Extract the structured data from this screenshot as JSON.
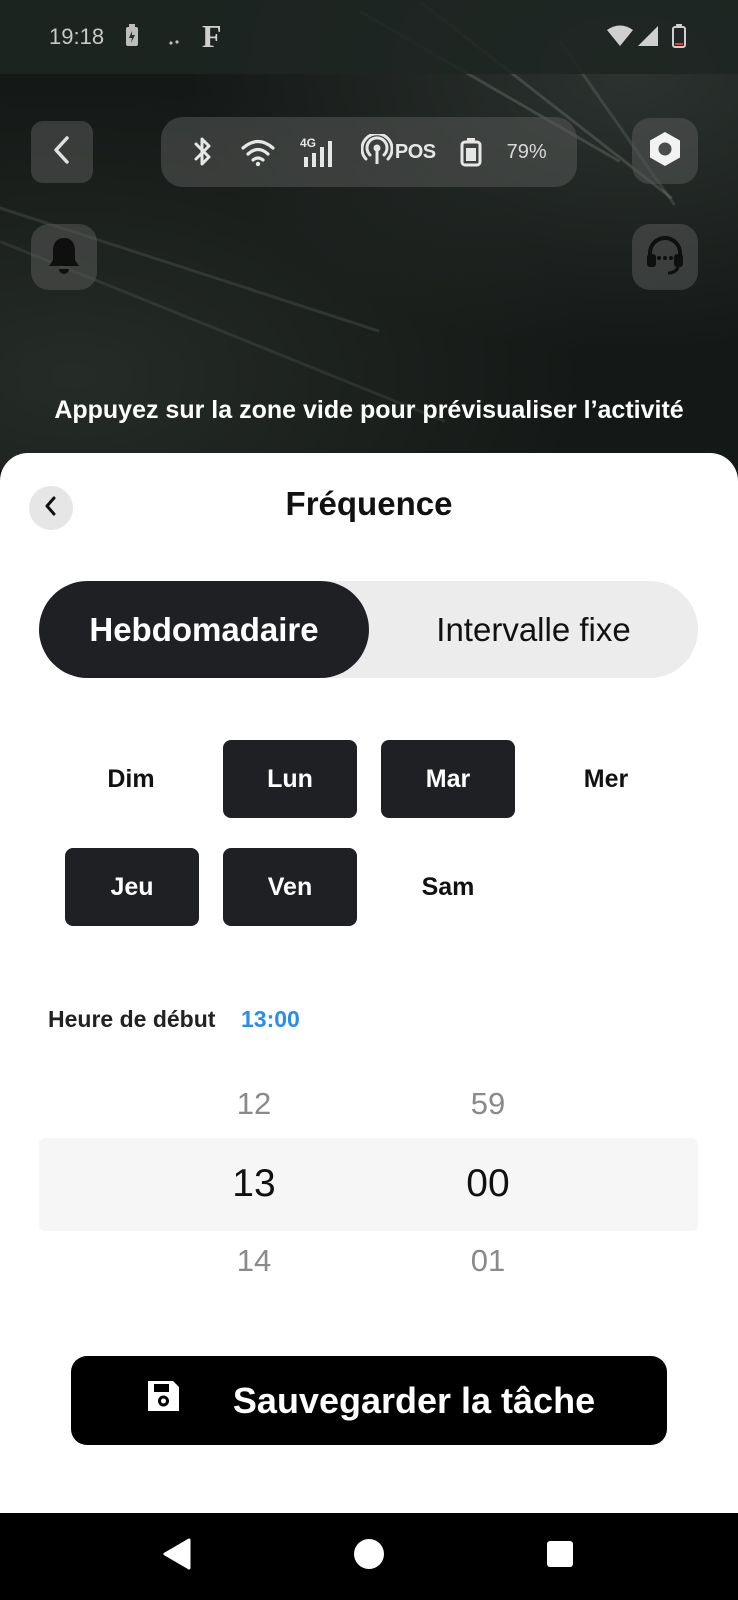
{
  "status_bar": {
    "time": "19:18",
    "logo": "F",
    "icons": [
      "battery-saver-icon",
      "dots-icon",
      "wifi-icon",
      "signal-icon",
      "battery-low-icon"
    ]
  },
  "map_controls": {
    "back_icon": "chevron-left-icon",
    "settings_icon": "hexagon-icon",
    "notification_icon": "bell-icon",
    "support_icon": "headset-icon"
  },
  "device_status": {
    "network_label": "4G",
    "pos_label": "POS",
    "battery_percent": "79%"
  },
  "hint": "Appuyez sur la zone vide pour prévisualiser l’activité",
  "sheet": {
    "title": "Fréquence",
    "modes": [
      {
        "label": "Hebdomadaire",
        "active": true
      },
      {
        "label": "Intervalle fixe",
        "active": false
      }
    ],
    "days": [
      {
        "label": "Dim",
        "selected": false
      },
      {
        "label": "Lun",
        "selected": true
      },
      {
        "label": "Mar",
        "selected": true
      },
      {
        "label": "Mer",
        "selected": false
      },
      {
        "label": "Jeu",
        "selected": true
      },
      {
        "label": "Ven",
        "selected": true
      },
      {
        "label": "Sam",
        "selected": false
      }
    ],
    "start_time": {
      "label": "Heure de début",
      "value": "13:00"
    },
    "picker": {
      "hours": {
        "prev": "12",
        "current": "13",
        "next": "14"
      },
      "minutes": {
        "prev": "59",
        "current": "00",
        "next": "01"
      }
    },
    "save_label": "Sauvegarder la tâche"
  },
  "colors": {
    "dark": "#1f2024",
    "accent_blue": "#2a8cf0",
    "sheet_bg": "#ffffff"
  }
}
